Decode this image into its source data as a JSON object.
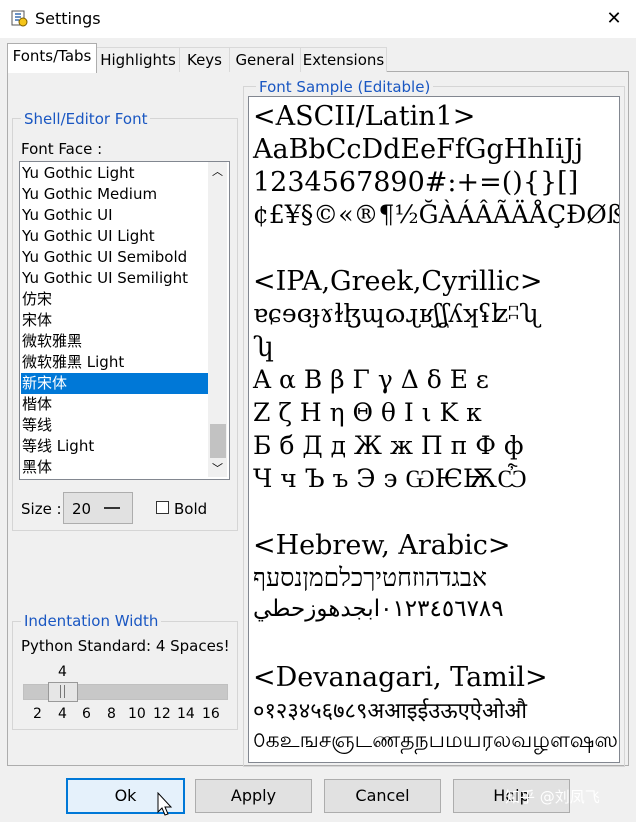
{
  "window": {
    "title": "Settings",
    "close_glyph": "✕"
  },
  "tabs": [
    {
      "label": "Fonts/Tabs"
    },
    {
      "label": "Highlights"
    },
    {
      "label": "Keys"
    },
    {
      "label": "General"
    },
    {
      "label": "Extensions"
    }
  ],
  "font_group": {
    "title": "Shell/Editor Font",
    "face_label": "Font Face :",
    "fonts": [
      "Yu Gothic Light",
      "Yu Gothic Medium",
      "Yu Gothic UI",
      "Yu Gothic UI Light",
      "Yu Gothic UI Semibold",
      "Yu Gothic UI Semilight",
      "仿宋",
      "宋体",
      "微软雅黑",
      "微软雅黑 Light",
      "新宋体",
      "楷体",
      "等线",
      "等线 Light",
      "黑体"
    ],
    "selected_font": "新宋体",
    "size_label": "Size :",
    "size_value": "20",
    "bold_label": "Bold",
    "bold_checked": false
  },
  "indent_group": {
    "title": "Indentation Width",
    "note": "Python Standard: 4 Spaces!",
    "current_value": "4",
    "ticks": [
      "2",
      "4",
      "6",
      "8",
      "10",
      "12",
      "14",
      "16"
    ],
    "slider_fraction": 0.143
  },
  "sample": {
    "title": "Font Sample (Editable)",
    "lines": [
      "<ASCII/Latin1>",
      "AaBbCcDdEeFfGgHhIiJj",
      "1234567890#:+=(){}[]",
      "¢£¥§©«®¶½ĞÀÁÂÃÄÅÇÐØß",
      "",
      "<IPA,Greek,Cyrillic>",
      "ɐɕɘɞɟɤɫɮɰɷɻʁʃʆʎʞʢʫʭʯ",
      "ʮ",
      "Α α Β β Γ γ Δ δ Ε ε",
      "Ζ ζ Η η Θ θ Ι ι Κ κ",
      "Б б Д д Ж ж П п Ф ф",
      "Ч ч Ъ ъ Э э ѠѤѬѼ",
      "",
      "<Hebrew, Arabic>",
      "אבגדהוזחטיךכלםמןנסעף",
      "٠١٢٣٤٥٦٧٨٩ابجدهوزحطي",
      "",
      "<Devanagari, Tamil>",
      "०१२३४५६७८९अआइईउऊएऐओऔ",
      "௦கஉஙசஞடணதநபமயரலவழளஷஸ"
    ]
  },
  "buttons": {
    "ok": "Ok",
    "apply": "Apply",
    "cancel": "Cancel",
    "help": "Help"
  },
  "watermark": "知乎 @刘凤飞",
  "colors": {
    "accent": "#0078d7",
    "group_title": "#1a57c2"
  }
}
